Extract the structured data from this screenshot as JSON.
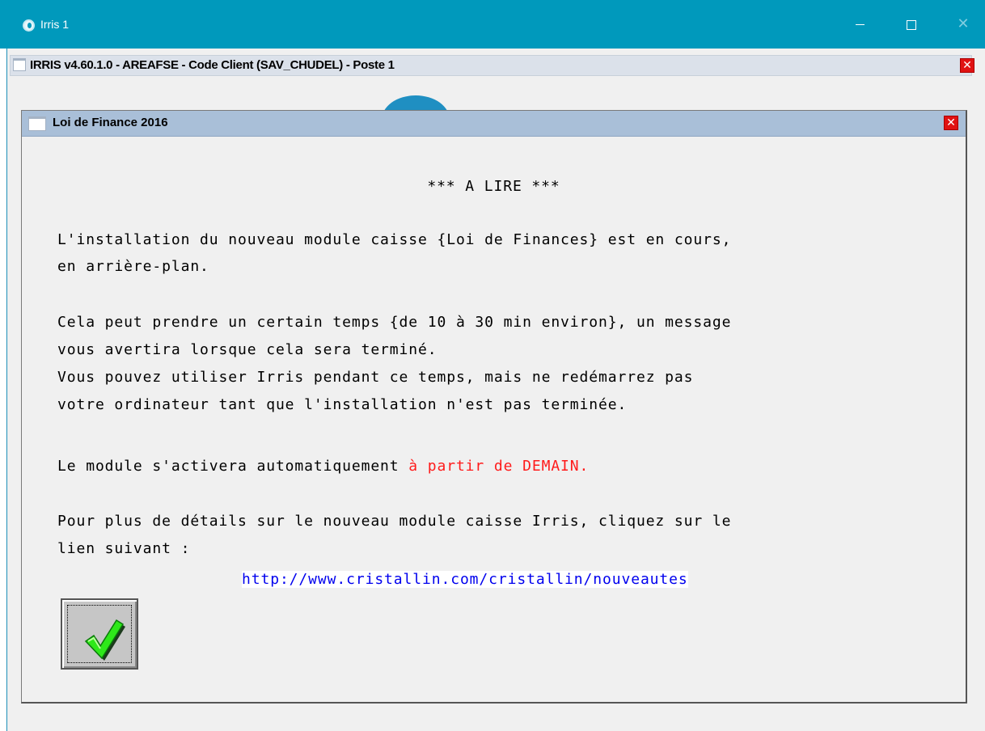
{
  "window": {
    "title": "Irris 1",
    "minimize_glyph": "",
    "close_glyph": "✕"
  },
  "app": {
    "title": "IRRIS v4.60.1.0  - AREAFSE - Code Client (SAV_CHUDEL) - Poste 1",
    "close_glyph": "✕"
  },
  "dialog": {
    "title": "Loi de Finance 2016",
    "close_glyph": "✕",
    "header": "*** A LIRE ***",
    "lines": {
      "l1": "L'installation du nouveau module caisse {Loi de Finances} est en cours,",
      "l2": "en arrière-plan.",
      "l3": "Cela peut prendre un certain temps {de 10 à 30 min environ}, un message",
      "l4": "vous avertira lorsque cela sera terminé.",
      "l5": "Vous pouvez utiliser Irris pendant ce temps, mais ne redémarrez pas",
      "l6": "votre ordinateur tant que l'installation n'est pas terminée.",
      "l7_prefix": "Le module s'activera automatiquement ",
      "l7_highlight": "à partir de DEMAIN.",
      "l8": "Pour plus de détails sur le nouveau module caisse Irris, cliquez sur le",
      "l9": "lien suivant :"
    },
    "link": "http://www.cristallin.com/cristallin/nouveautes",
    "highlight_color": "#ff1b1b",
    "link_color": "#0000ee"
  },
  "icons": {
    "app": "irris-app-icon",
    "ok": "green-checkmark-icon",
    "close": "close-icon"
  }
}
